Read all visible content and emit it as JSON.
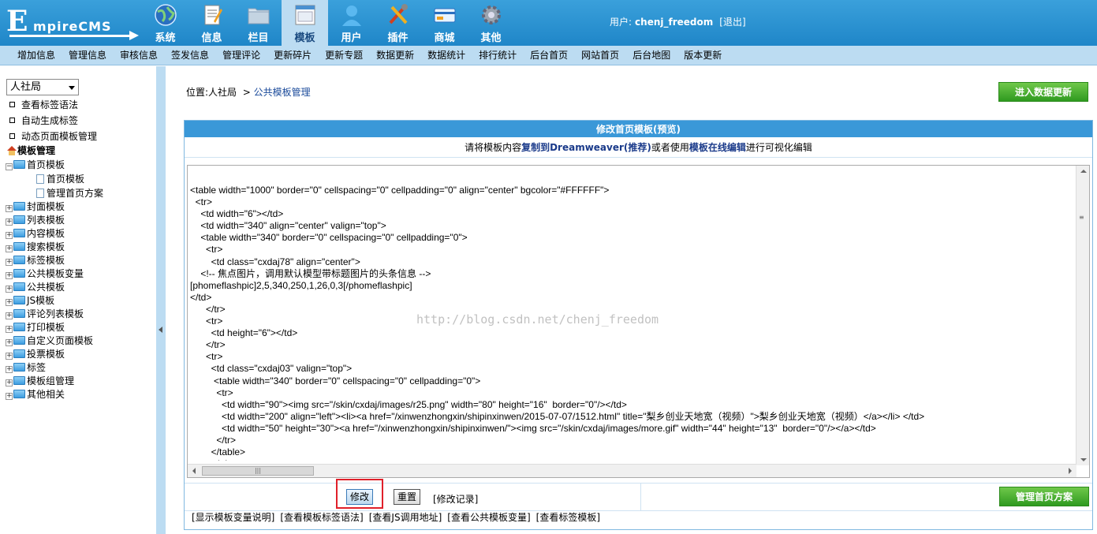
{
  "logo": {
    "big_letter": "E",
    "text": "mpireCMS"
  },
  "nav": [
    {
      "label": "系统",
      "icon": "globe-icon"
    },
    {
      "label": "信息",
      "icon": "document-icon"
    },
    {
      "label": "栏目",
      "icon": "folder-icon"
    },
    {
      "label": "模板",
      "icon": "template-icon",
      "active": true
    },
    {
      "label": "用户",
      "icon": "user-icon"
    },
    {
      "label": "插件",
      "icon": "tools-icon"
    },
    {
      "label": "商城",
      "icon": "card-icon"
    },
    {
      "label": "其他",
      "icon": "gear-icon"
    }
  ],
  "user": {
    "prefix": "用户:",
    "name": "chenj_freedom",
    "logout": "[退出]"
  },
  "submenu": [
    "增加信息",
    "管理信息",
    "审核信息",
    "签发信息",
    "管理评论",
    "更新碎片",
    "更新专题",
    "数据更新",
    "数据统计",
    "排行统计",
    "后台首页",
    "网站首页",
    "后台地图",
    "版本更新"
  ],
  "sidebar": {
    "site_select": "人社局",
    "links": [
      "查看标签语法",
      "自动生成标签",
      "动态页面模板管理"
    ],
    "tree_title": "模板管理",
    "tree": {
      "root": "首页模板",
      "children": [
        "首页模板",
        "管理首页方案"
      ],
      "nodes": [
        "封面模板",
        "列表模板",
        "内容模板",
        "搜索模板",
        "标签模板",
        "公共模板变量",
        "公共模板",
        "JS模板",
        "评论列表模板",
        "打印模板",
        "自定义页面模板",
        "投票模板",
        "标签",
        "模板组管理",
        "其他相关"
      ]
    }
  },
  "main": {
    "location_prefix": "位置:",
    "location_site": "人社局",
    "location_sep": ">",
    "location_page": "公共模板管理",
    "update_button": "进入数据更新",
    "panel_title": "修改首页模板(预览)",
    "tip": {
      "t1": "请将模板内容",
      "b1": "复制到Dreamweaver(推荐)",
      "t2": "或者使用",
      "b2": "模板在线编辑",
      "t3": "进行可视化编辑"
    },
    "code_lines": [
      "<table width=\"1000\" border=\"0\" cellspacing=\"0\" cellpadding=\"0\" align=\"center\" bgcolor=\"#FFFFFF\">",
      "  <tr>",
      "    <td width=\"6\"></td>",
      "    <td width=\"340\" align=\"center\" valign=\"top\">",
      "    <table width=\"340\" border=\"0\" cellspacing=\"0\" cellpadding=\"0\">",
      "      <tr>",
      "        <td class=\"cxdaj78\" align=\"center\">",
      "    <!-- 焦点图片，调用默认模型带标题图片的头条信息 -->",
      "[phomeflashpic]2,5,340,250,1,26,0,3[/phomeflashpic]",
      "</td>",
      "      </tr>",
      "      <tr>",
      "        <td height=\"6\"></td>",
      "      </tr>",
      "      <tr>",
      "        <td class=\"cxdaj03\" valign=\"top\">",
      "         <table width=\"340\" border=\"0\" cellspacing=\"0\" cellpadding=\"0\">",
      "          <tr>",
      "            <td width=\"90\"><img src=\"/skin/cxdaj/images/r25.png\" width=\"80\" height=\"16\"  border=\"0\"/></td>",
      "            <td width=\"200\" align=\"left\"><li><a href=\"/xinwenzhongxin/shipinxinwen/2015-07-07/1512.html\" title=\"梨乡创业天地宽（视频）\">梨乡创业天地宽（视频）</a></li> </td>",
      "            <td width=\"50\" height=\"30\"><a href=\"/xinwenzhongxin/shipinxinwen/\"><img src=\"/skin/cxdaj/images/more.gif\" width=\"44\" height=\"13\"  border=\"0\"/></a></td>",
      "          </tr>",
      "        </table>",
      "        </td>"
    ],
    "watermark": "http://blog.csdn.net/chenj_freedom",
    "modify_button": "修改",
    "reset_button": "重置",
    "history_link": "[修改记录]",
    "manage_button": "管理首页方案",
    "bottom_links": [
      "[显示模板变量说明]",
      "[查看模板标签语法]",
      "[查看JS调用地址]",
      "[查看公共模板变量]",
      "[查看标签模板]"
    ]
  }
}
